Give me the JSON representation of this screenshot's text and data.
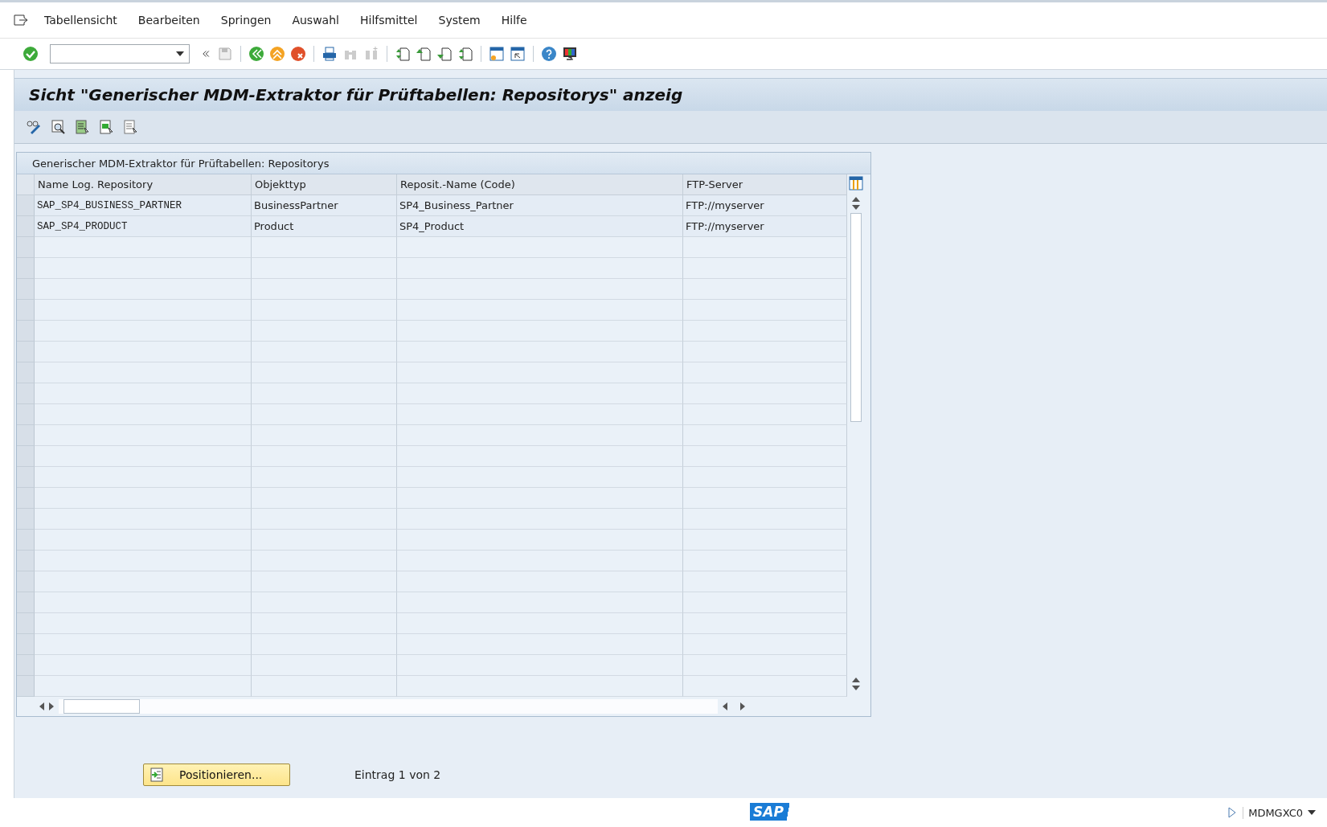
{
  "menu": [
    "Tabellensicht",
    "Bearbeiten",
    "Springen",
    "Auswahl",
    "Hilfsmittel",
    "System",
    "Hilfe"
  ],
  "title": "Sicht \"Generischer MDM-Extraktor für Prüftabellen: Repositorys\" anzeig",
  "table": {
    "title": "Generischer MDM-Extraktor für Prüftabellen: Repositorys",
    "columns": [
      "Name Log. Repository",
      "Objekttyp",
      "Reposit.-Name (Code)",
      "FTP-Server"
    ],
    "rows": [
      {
        "cells": [
          "SAP_SP4_BUSINESS_PARTNER",
          "BusinessPartner",
          "SP4_Business_Partner",
          "FTP://myserver"
        ],
        "selected": false
      },
      {
        "cells": [
          "SAP_SP4_PRODUCT",
          "Product",
          "SP4_Product",
          "FTP://myserver"
        ],
        "selected": false
      }
    ]
  },
  "position_button": "Positionieren...",
  "entry_info": "Eintrag 1 von 2",
  "status_bar": {
    "logo": "SAP",
    "system": "MDMGXC0"
  }
}
